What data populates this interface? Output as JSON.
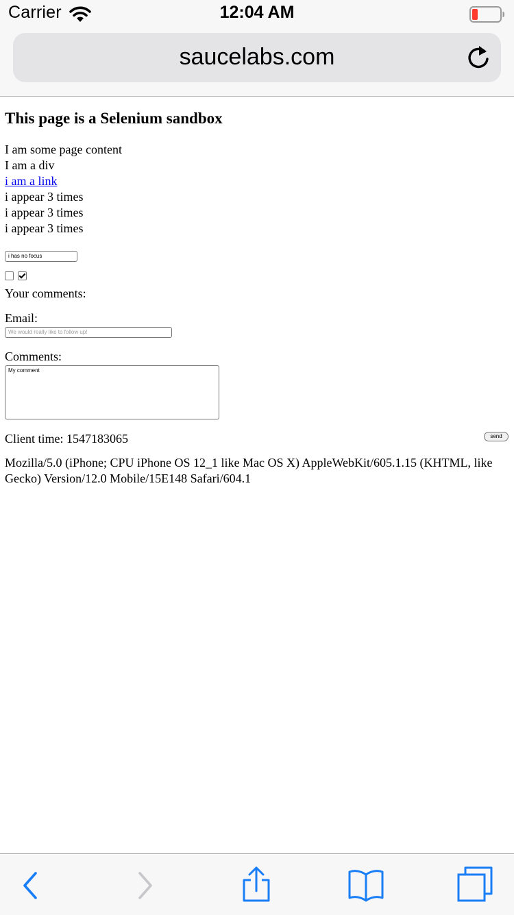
{
  "status_bar": {
    "carrier": "Carrier",
    "time": "12:04 AM",
    "wifi_icon": "wifi-icon",
    "battery_icon": "battery-low-icon",
    "battery_color": "#ff3b30"
  },
  "address_bar": {
    "url": "saucelabs.com",
    "reload_icon": "reload-icon"
  },
  "page": {
    "title": "This page is a Selenium sandbox",
    "lines": [
      "I am some page content",
      "I am a div"
    ],
    "link_text": "i am a link",
    "repeated": [
      "i appear 3 times",
      "i appear 3 times",
      "i appear 3 times"
    ],
    "focus_input_value": "i has no focus",
    "checkbox1_checked": false,
    "checkbox2_checked": true,
    "your_comments_label": "Your comments:",
    "email_label": "Email:",
    "email_placeholder": "We would really like to follow up!",
    "comments_label": "Comments:",
    "comments_value": "My comment",
    "client_time_label": "Client time: 1547183065",
    "send_label": "send",
    "user_agent": "Mozilla/5.0 (iPhone; CPU iPhone OS 12_1 like Mac OS X) AppleWebKit/605.1.15 (KHTML, like Gecko) Version/12.0 Mobile/15E148 Safari/604.1"
  },
  "toolbar": {
    "accent_color": "#1a7ef7",
    "disabled_color": "#c7c7cc",
    "items": [
      "back-icon",
      "forward-icon",
      "share-icon",
      "bookmarks-icon",
      "tabs-icon"
    ]
  }
}
